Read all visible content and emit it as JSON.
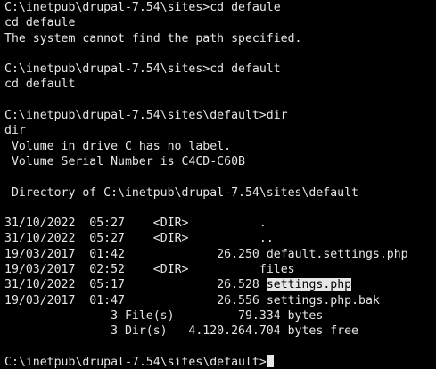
{
  "terminal": {
    "prompt1": "C:\\inetpub\\drupal-7.54\\sites>cd defaule",
    "echo1": "cd defaule",
    "error1": "The system cannot find the path specified.",
    "prompt2": "C:\\inetpub\\drupal-7.54\\sites>cd default",
    "echo2": "cd default",
    "prompt3": "C:\\inetpub\\drupal-7.54\\sites\\default>dir",
    "echo3": "dir",
    "volume_label": " Volume in drive C has no label.",
    "volume_serial": " Volume Serial Number is C4CD-C60B",
    "directory_of": " Directory of C:\\inetpub\\drupal-7.54\\sites\\default",
    "listing": [
      {
        "date": "31/10/2022",
        "time": "05:27",
        "type": "<DIR>",
        "size": "",
        "name": "."
      },
      {
        "date": "31/10/2022",
        "time": "05:27",
        "type": "<DIR>",
        "size": "",
        "name": ".."
      },
      {
        "date": "19/03/2017",
        "time": "01:42",
        "type": "",
        "size": "26.250",
        "name": "default.settings.php"
      },
      {
        "date": "19/03/2017",
        "time": "02:52",
        "type": "<DIR>",
        "size": "",
        "name": "files"
      },
      {
        "date": "31/10/2022",
        "time": "05:17",
        "type": "",
        "size": "26.528",
        "name": "settings.php"
      },
      {
        "date": "19/03/2017",
        "time": "01:47",
        "type": "",
        "size": "26.556",
        "name": "settings.php.bak"
      }
    ],
    "summary_files": "               3 File(s)         79.334 bytes",
    "summary_dirs": "               3 Dir(s)   4.120.264.704 bytes free",
    "final_prompt": "C:\\inetpub\\drupal-7.54\\sites\\default>"
  }
}
